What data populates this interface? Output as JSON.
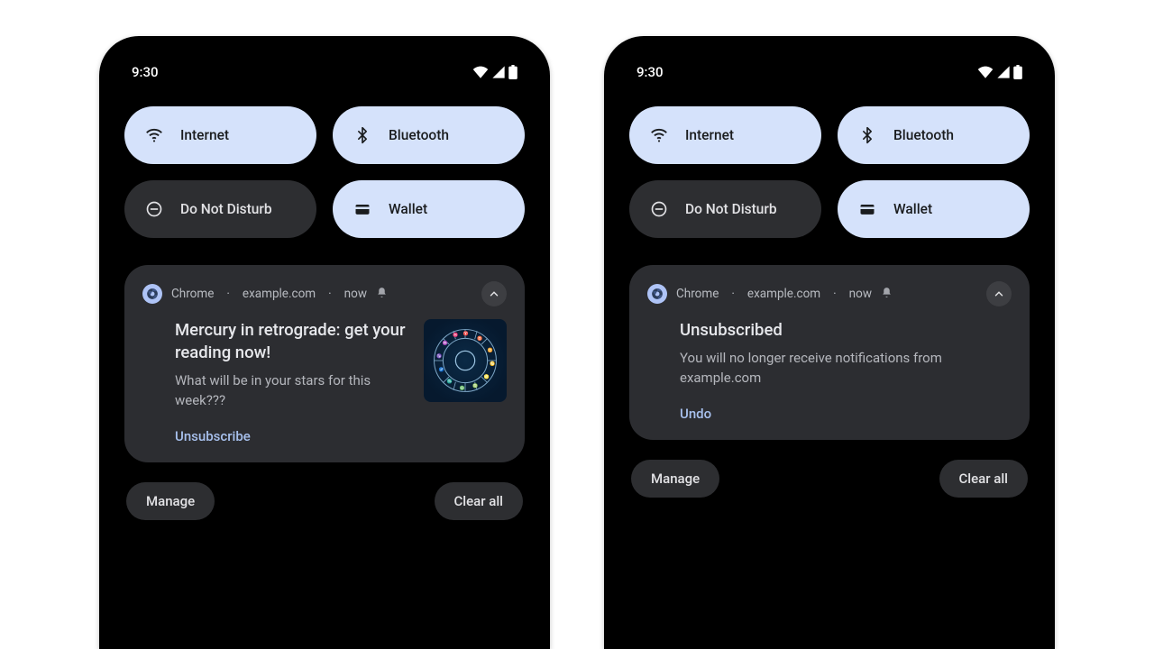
{
  "status": {
    "time": "9:30"
  },
  "qs": {
    "internet": "Internet",
    "bluetooth": "Bluetooth",
    "dnd": "Do Not Disturb",
    "wallet": "Wallet"
  },
  "phones": [
    {
      "meta": {
        "app": "Chrome",
        "site": "example.com",
        "when": "now"
      },
      "title": "Mercury in retrograde: get your reading now!",
      "body": "What will be in your stars for this week???",
      "action": "Unsubscribe",
      "has_thumb": true
    },
    {
      "meta": {
        "app": "Chrome",
        "site": "example.com",
        "when": "now"
      },
      "title": "Unsubscribed",
      "body": "You will no longer receive notifications from example.com",
      "action": "Undo",
      "has_thumb": false
    }
  ],
  "footer": {
    "manage": "Manage",
    "clear": "Clear all"
  },
  "colors": {
    "tile_on": "#d5e2fb",
    "tile_off": "#2d2e31",
    "accent_text": "#a8c1ee"
  }
}
